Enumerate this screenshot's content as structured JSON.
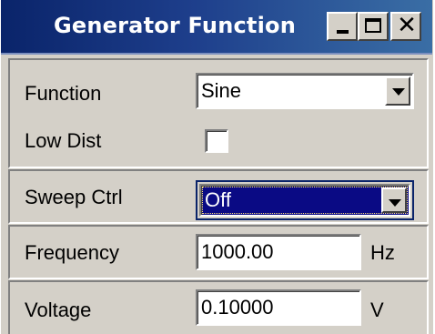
{
  "window": {
    "title": "Generator Function",
    "minimize_icon": "minimize-icon",
    "maximize_icon": "maximize-icon",
    "close_icon": "close-icon"
  },
  "fields": {
    "function": {
      "label": "Function",
      "value": "Sine"
    },
    "low_dist": {
      "label": "Low Dist",
      "checked": false
    },
    "sweep_ctrl": {
      "label": "Sweep Ctrl",
      "value": "Off"
    },
    "frequency": {
      "label": "Frequency",
      "value": "1000.00",
      "unit": "Hz"
    },
    "voltage": {
      "label": "Voltage",
      "value": "0.10000",
      "unit": "V"
    }
  },
  "colors": {
    "titlebar_start": "#0a246a",
    "titlebar_end": "#3a6ea5",
    "panel": "#d4d0c8",
    "selection": "#0a0a84"
  }
}
